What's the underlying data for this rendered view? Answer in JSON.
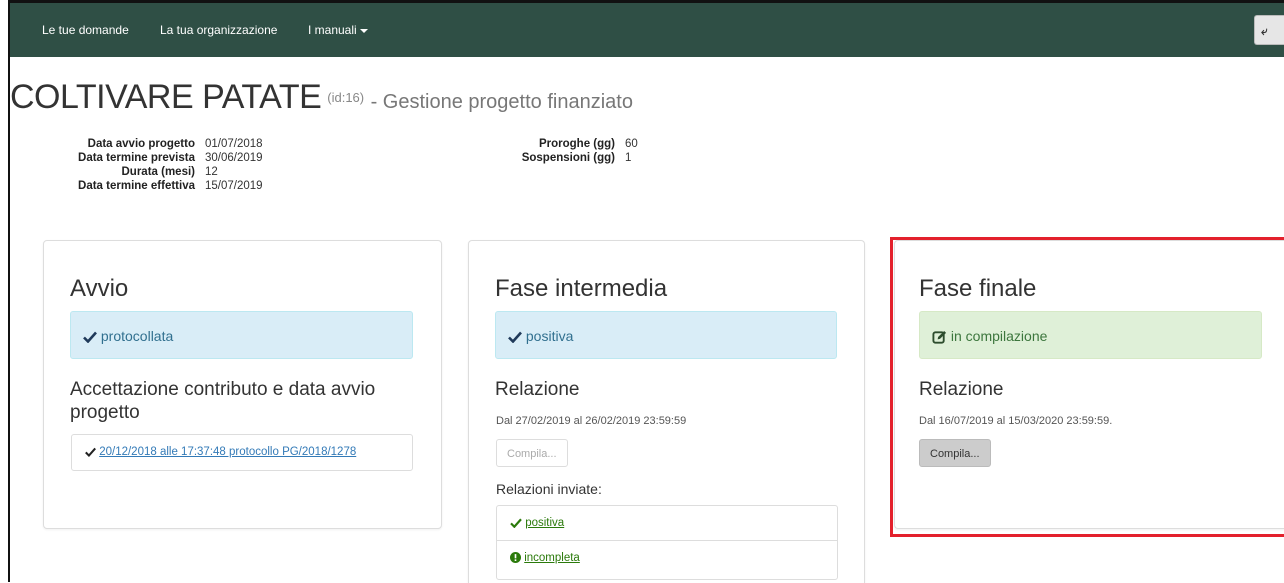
{
  "nav": {
    "items": [
      "Le tue domande",
      "La tua organizzazione",
      "I manuali"
    ],
    "logout_label": "⤶"
  },
  "header": {
    "title": "COLTIVARE PATATE",
    "id_label": "(id:16)",
    "subtitle": "- Gestione progetto finanziato"
  },
  "details_left": [
    {
      "key": "Data avvio progetto",
      "value": "01/07/2018"
    },
    {
      "key": "Data termine prevista",
      "value": "30/06/2019"
    },
    {
      "key": "Durata (mesi)",
      "value": "12"
    },
    {
      "key": "Data termine effettiva",
      "value": "15/07/2019"
    }
  ],
  "details_right": [
    {
      "key": "Proroghe (gg)",
      "value": "60"
    },
    {
      "key": "Sospensioni (gg)",
      "value": "1"
    }
  ],
  "panels": {
    "avvio": {
      "title": "Avvio",
      "status": "protocollata",
      "section_title": "Accettazione contributo e data avvio progetto",
      "link": "20/12/2018 alle 17:37:48 protocollo PG/2018/1278"
    },
    "intermedia": {
      "title": "Fase intermedia",
      "status": "positiva",
      "section_title": "Relazione",
      "period": "Dal 27/02/2019 al 26/02/2019 23:59:59",
      "button": "Compila...",
      "sent_title": "Relazioni inviate:",
      "sent": [
        "positiva",
        "incompleta"
      ]
    },
    "finale": {
      "title": "Fase finale",
      "status": "in compilazione",
      "section_title": "Relazione",
      "period": "Dal 16/07/2019 al 15/03/2020 23:59:59.",
      "button": "Compila..."
    }
  },
  "colors": {
    "navbar": "#2f4f45",
    "alert_info": "#d9edf7",
    "alert_success": "#dff0d8",
    "highlight": "#e3202c"
  }
}
